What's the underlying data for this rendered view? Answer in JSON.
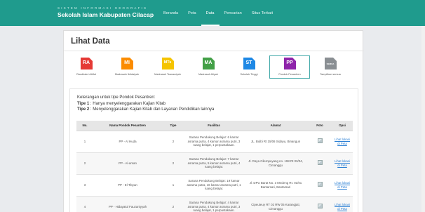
{
  "header": {
    "subtitle": "SISTEM INFORMASI GEOGRAFIS",
    "title": "Sekolah Islam Kabupaten Cilacap"
  },
  "nav": [
    {
      "label": "Beranda"
    },
    {
      "label": "Peta"
    },
    {
      "label": "Data"
    },
    {
      "label": "Pencarian"
    },
    {
      "label": "Situs Terkait"
    }
  ],
  "page_title": "Lihat Data",
  "categories": [
    {
      "code": "RA",
      "label": "Raudhatul Athfal",
      "color": "#e53935"
    },
    {
      "code": "MI",
      "label": "Madrasah Ibtidaiyah",
      "color": "#fb8c00"
    },
    {
      "code": "MTs",
      "label": "Madrasah Tsanawiyah",
      "color": "#f5c400"
    },
    {
      "code": "MA",
      "label": "Madrasah Aliyah",
      "color": "#43a047"
    },
    {
      "code": "ST",
      "label": "Sekolah Tinggi",
      "color": "#1e88e5"
    },
    {
      "code": "PP",
      "label": "Pondok Pesantren",
      "color": "#8e24aa"
    },
    {
      "code": "SEMUA",
      "label": "Tampilkan semua",
      "color": "#8a8f93"
    }
  ],
  "info": {
    "intro": "Keterangan untuk tipe Pondok Pesantren:",
    "tipe1_label": "Tipe 1",
    "tipe1_text": ": Hanya menyelenggarakan Kajian Kitab",
    "tipe2_label": "Tipe 2",
    "tipe2_text": ": Menyelenggarakan Kajian Kitab dan Layanan Pendidikan lainnya"
  },
  "table": {
    "headers": [
      "No.",
      "Nama Pondok Pesantren",
      "Tipe",
      "Fasilitas",
      "Alamat",
      "Foto",
      "Opsi"
    ],
    "rows": [
      {
        "no": "1",
        "nama": "PP - Al Huda",
        "tipe": "2",
        "fasilitas": "Sarana Pendukung Belajar: 6 kamar asrama putra, 4 kamar asrama putri, 3 ruang belajar, 1 perpustakaan.",
        "alamat": "JL. Bulbi Rt 15/06 Sidayu, Binangun",
        "opsi": "Lihat lokasi di Peta"
      },
      {
        "no": "2",
        "nama": "PP - Al-aman",
        "tipe": "2",
        "fasilitas": "Sarana Pendukung Belajar: 7 kamar asrama putra, 5 kamar asrama putri, 4 ruang belajar.",
        "alamat": "Jl. Raya Cilempuyang no. 198 Rt 03/04, Cimanggu",
        "opsi": "Lihat lokasi di Peta"
      },
      {
        "no": "3",
        "nama": "PP - El Tibyan",
        "tipe": "1",
        "fasilitas": "Sarana Pendukung Belajar: 19 kamar asrama putra, 16 kamar asrama putri, 1 ruang belajar.",
        "alamat": "Jl. DPU Barat No. 3 Medeng Rt. 01/01 Bantarsari, Bantarsari",
        "opsi": "Lihat lokasi di Peta"
      },
      {
        "no": "4",
        "nama": "PP - Hidayatul Fauzaniyyah",
        "tipe": "2",
        "fasilitas": "Sarana Pendukung Belajar: 4 kamar asrama putra, 4 kamar asrama putri, 3 ruang belajar, 1 perpustakaan.",
        "alamat": "Cipeuteuy RT 02 RW 05 Karangjati, Cimanggu",
        "opsi": "Lihat lokasi di Peta"
      }
    ]
  },
  "colors": {
    "header": "#1f9b8d",
    "link": "#2a7fd4"
  }
}
